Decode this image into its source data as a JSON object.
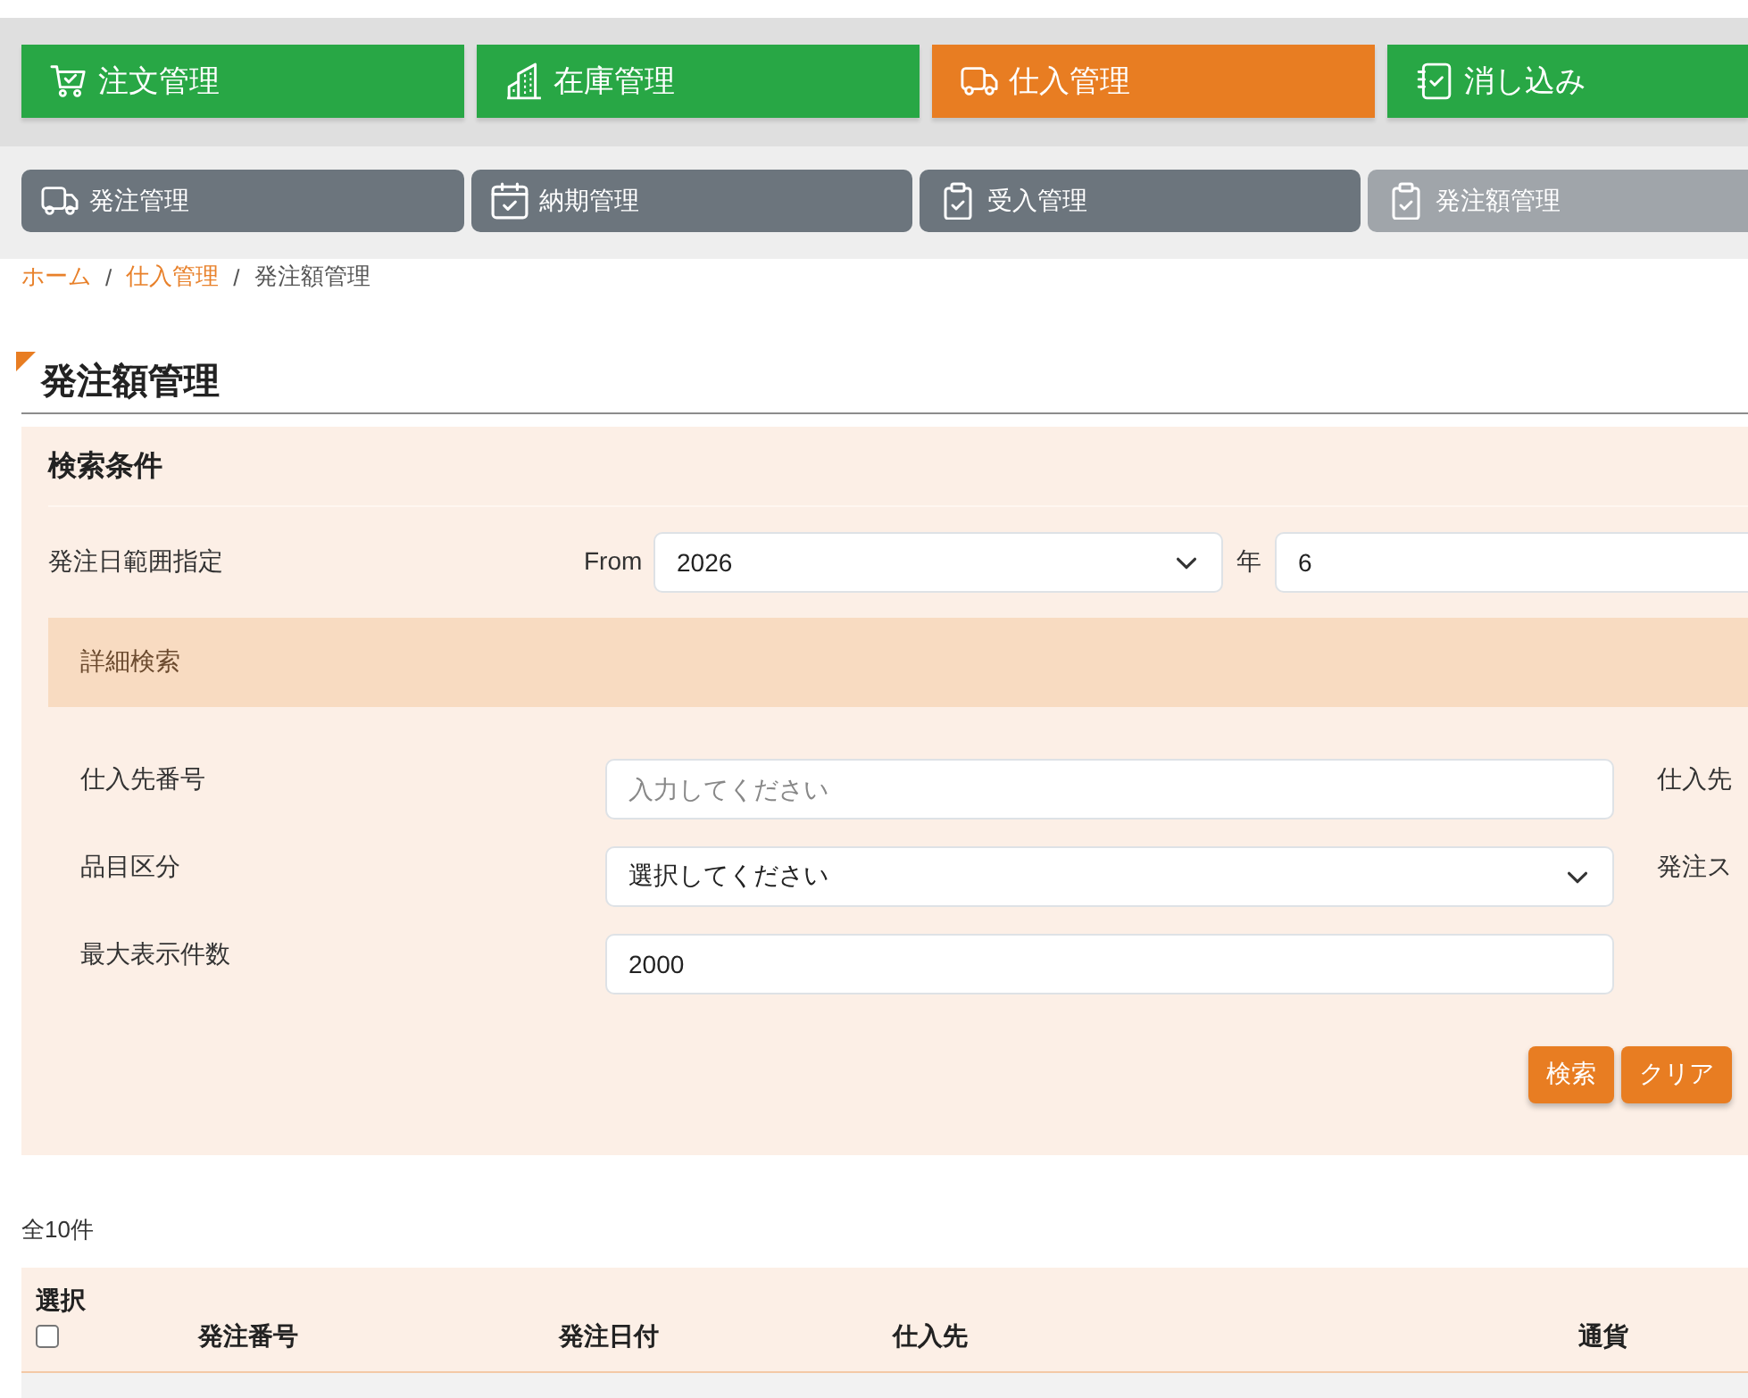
{
  "main_tabs": [
    {
      "label": "注文管理",
      "selected": false
    },
    {
      "label": "在庫管理",
      "selected": false
    },
    {
      "label": "仕入管理",
      "selected": true
    },
    {
      "label": "消し込み",
      "selected": false
    }
  ],
  "sub_tabs": [
    {
      "label": "発注管理",
      "selected": false
    },
    {
      "label": "納期管理",
      "selected": false
    },
    {
      "label": "受入管理",
      "selected": false
    },
    {
      "label": "発注額管理",
      "selected": true
    }
  ],
  "breadcrumb": [
    {
      "kind": "link",
      "text": "ホーム"
    },
    {
      "kind": "separator",
      "text": "/"
    },
    {
      "kind": "link",
      "text": "仕入管理"
    },
    {
      "kind": "separator",
      "text": "/"
    },
    {
      "kind": "current",
      "text": "発注額管理"
    }
  ],
  "page_title": "発注額管理",
  "search_panel": {
    "title": "検索条件",
    "date_range": {
      "label": "発注日範囲指定",
      "from_label": "From",
      "year_select": {
        "value": "2026"
      },
      "year_unit": "年",
      "month_input": {
        "value": "6"
      }
    },
    "detail_header": "詳細検索",
    "fields": [
      {
        "kind": "text",
        "label": "仕入先番号",
        "placeholder": "入力してください",
        "right_label": "仕入先"
      },
      {
        "kind": "select",
        "label": "品目区分",
        "value": "選択してください",
        "right_label": "発注ス"
      },
      {
        "kind": "text",
        "label": "最大表示件数",
        "value": "2000"
      }
    ],
    "buttons": [
      "検索",
      "クリア"
    ]
  },
  "table": {
    "count": "全10件",
    "select_label": "選択",
    "select_all_checked": false,
    "columns": [
      "発注番号",
      "発注日付",
      "仕入先",
      "通貨"
    ]
  }
}
